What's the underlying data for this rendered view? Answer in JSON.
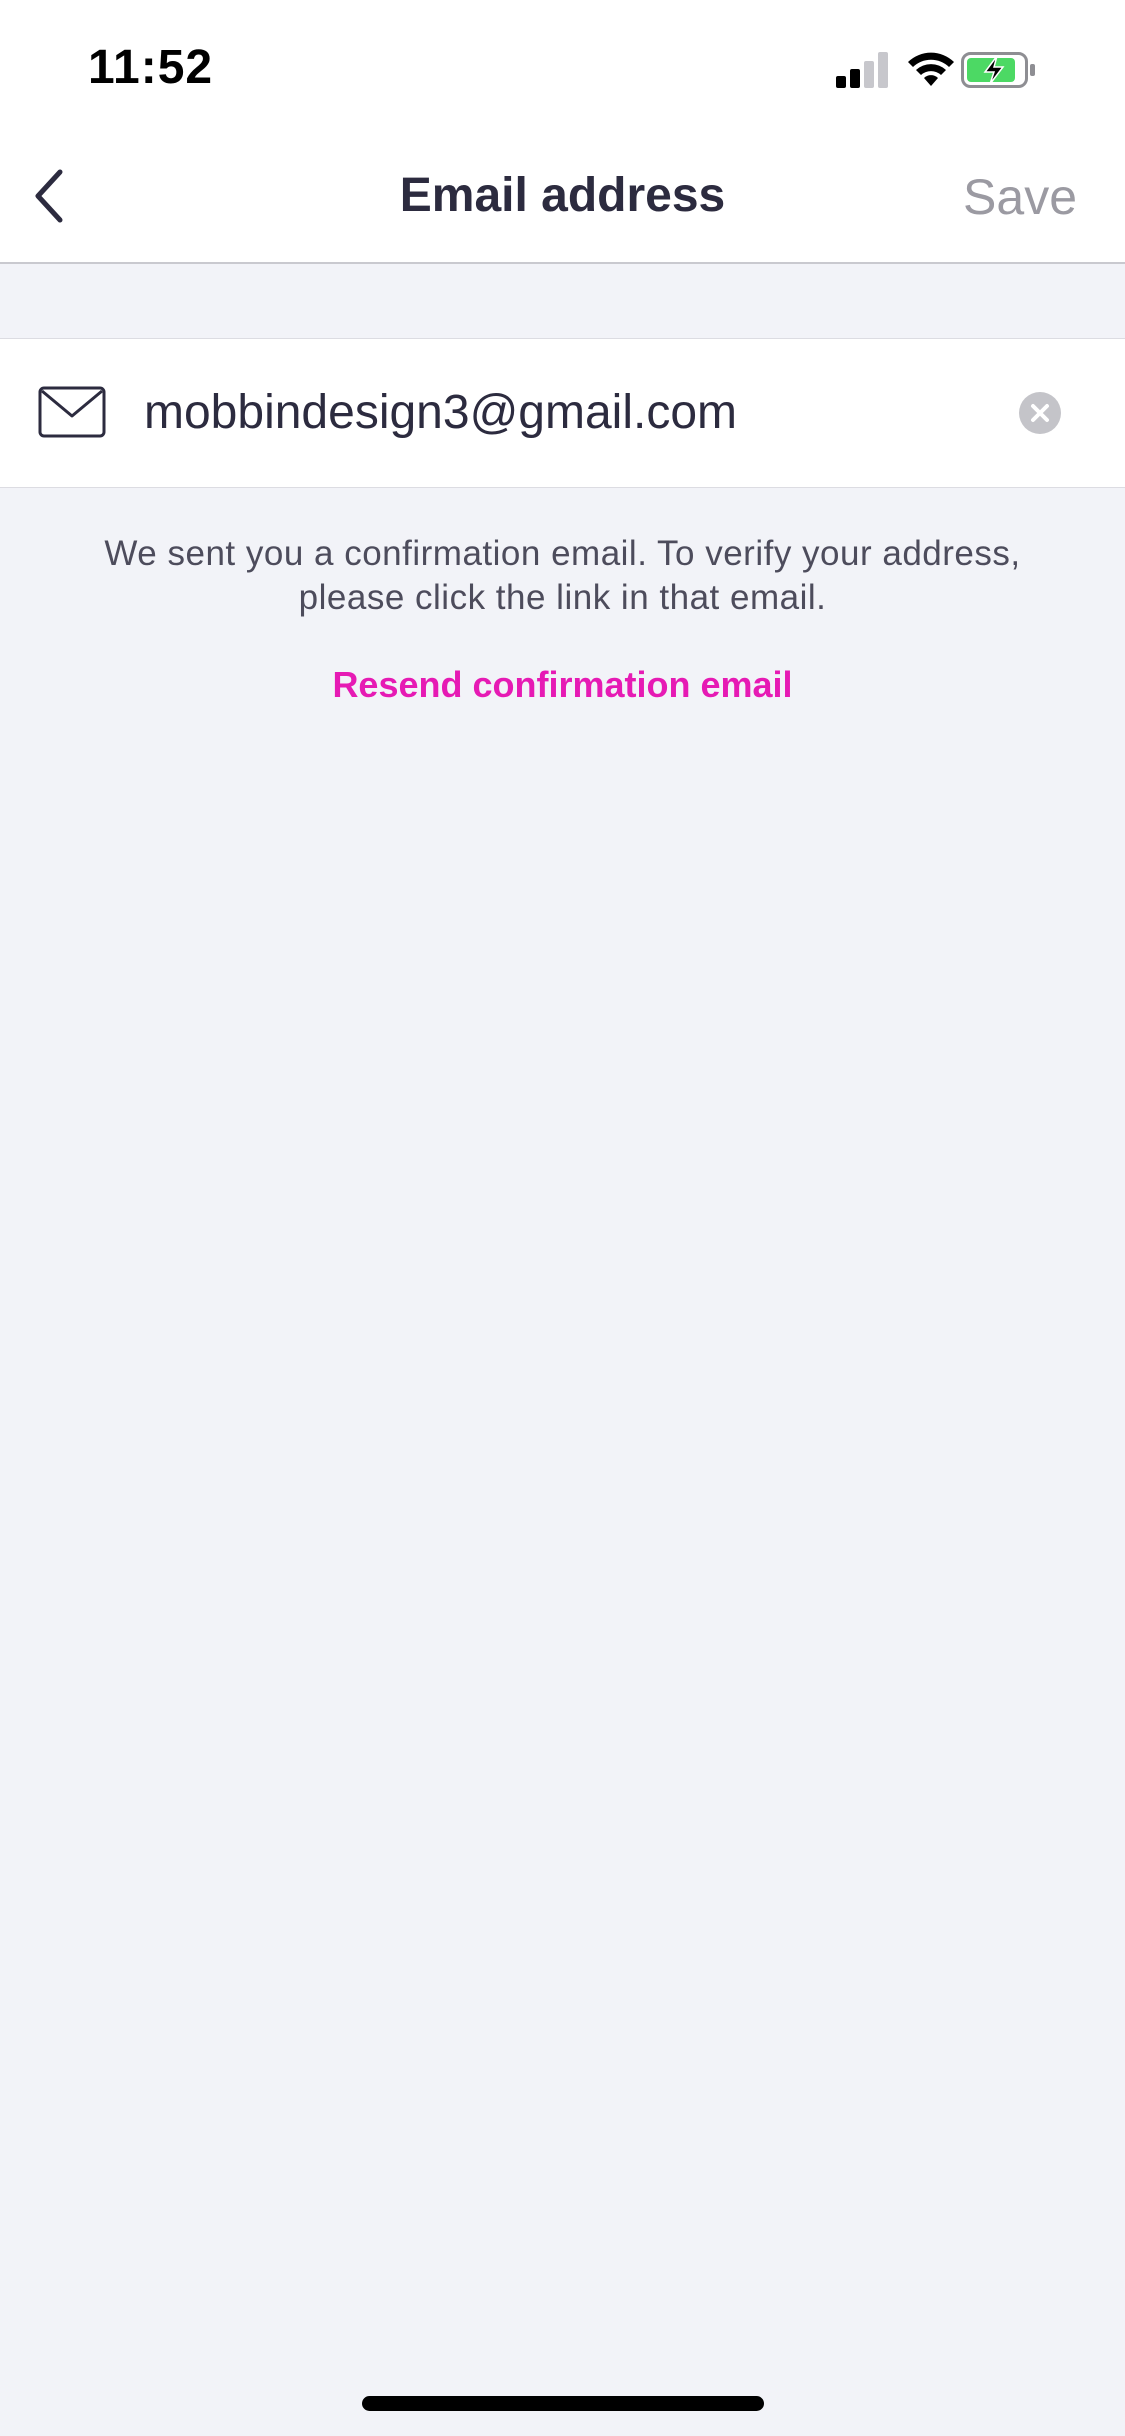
{
  "status_bar": {
    "time": "11:52",
    "icons": [
      "signal-icon",
      "wifi-icon",
      "battery-charging-icon"
    ]
  },
  "nav": {
    "title": "Email address",
    "save_label": "Save",
    "back_icon": "chevron-left-icon"
  },
  "email_field": {
    "value": "mobbindesign3@gmail.com",
    "icon": "mail-icon",
    "clear_icon": "clear-icon"
  },
  "info": {
    "message": "We sent you a confirmation email. To verify your address, please click the link in that email.",
    "resend_label": "Resend confirmation email"
  },
  "colors": {
    "accent": "#e61ab4",
    "background": "#f2f3f8",
    "title": "#2c2b3f",
    "save_disabled": "#9b9aa2",
    "battery_fill": "#4cd964"
  }
}
